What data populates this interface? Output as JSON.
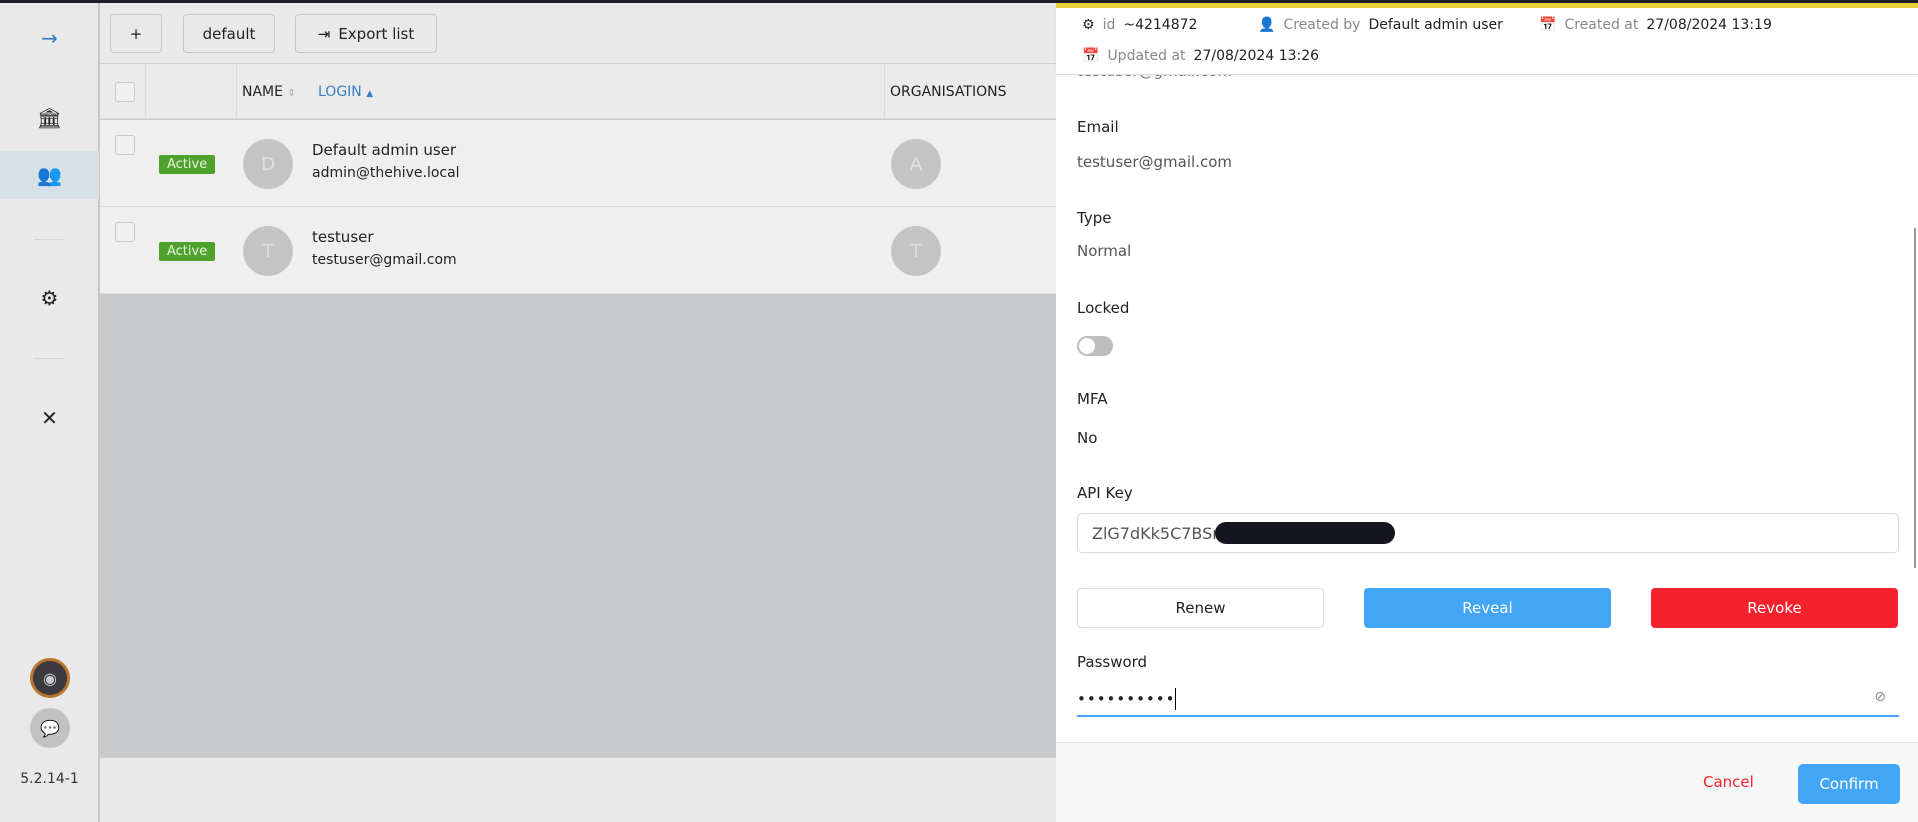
{
  "sidebar": {
    "icons": [
      "arrow-right-icon",
      "bank-icon",
      "users-icon",
      "sliders-icon",
      "tools-icon"
    ],
    "version": "5.2.14-1"
  },
  "toolbar": {
    "add_label": "+",
    "profile_label": "default",
    "export_label": "Export list"
  },
  "table": {
    "headers": {
      "name": "NAME",
      "login": "LOGIN",
      "organisations": "ORGANISATIONS"
    },
    "rows": [
      {
        "status": "Active",
        "initial": "D",
        "name": "Default admin user",
        "login": "admin@thehive.local",
        "org_initial": "A"
      },
      {
        "status": "Active",
        "initial": "T",
        "name": "testuser",
        "login": "testuser@gmail.com",
        "org_initial": "T"
      }
    ]
  },
  "drawer": {
    "meta": {
      "id_label": "id",
      "id_value": "~4214872",
      "created_by_label": "Created by",
      "created_by_value": "Default admin user",
      "created_at_label": "Created at",
      "created_at_value": "27/08/2024 13:19",
      "updated_at_label": "Updated at",
      "updated_at_value": "27/08/2024 13:26"
    },
    "hidden_login": "testuser@gmail.com",
    "email_label": "Email",
    "email_value": "testuser@gmail.com",
    "type_label": "Type",
    "type_value": "Normal",
    "locked_label": "Locked",
    "locked": false,
    "mfa_label": "MFA",
    "mfa_value": "No",
    "api_key_label": "API Key",
    "api_key_value": "ZlG7dKk5C7BSr",
    "renew_label": "Renew",
    "reveal_label": "Reveal",
    "revoke_label": "Revoke",
    "password_label": "Password",
    "password_value": "••••••••••",
    "cancel_label": "Cancel",
    "confirm_label": "Confirm"
  },
  "colors": {
    "accent": "#42a5f5",
    "danger": "#f5222d",
    "active": "#52c41a",
    "header_stripe": "#e8cf3c"
  }
}
